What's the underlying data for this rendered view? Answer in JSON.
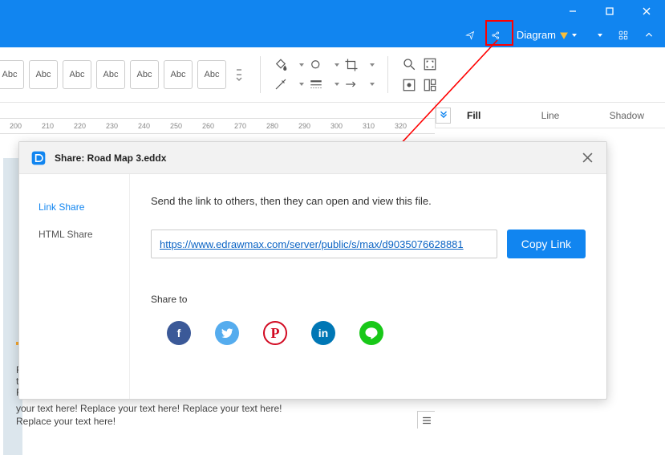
{
  "window": {},
  "menubar": {
    "diagram_label": "Diagram"
  },
  "toolbar": {
    "font_style": "Abc"
  },
  "right_panel": {
    "tab_fill": "Fill",
    "tab_line": "Line",
    "tab_shadow": "Shadow"
  },
  "ruler": {
    "ticks": [
      "200",
      "210",
      "220",
      "230",
      "240",
      "250",
      "260",
      "270",
      "280",
      "290",
      "300",
      "310",
      "320"
    ]
  },
  "body_text": {
    "line1": "R",
    "line2": "te",
    "line3": "R",
    "para": "your text here! Replace your text here!  Replace your text here! Replace your text here!"
  },
  "dialog": {
    "title": "Share: Road Map 3.eddx",
    "nav": {
      "link_share": "Link Share",
      "html_share": "HTML Share"
    },
    "instruction": "Send the link to others, then they can open and view this file.",
    "url": "https://www.edrawmax.com/server/public/s/max/d9035076628881",
    "copy_label": "Copy Link",
    "share_to": "Share to"
  }
}
